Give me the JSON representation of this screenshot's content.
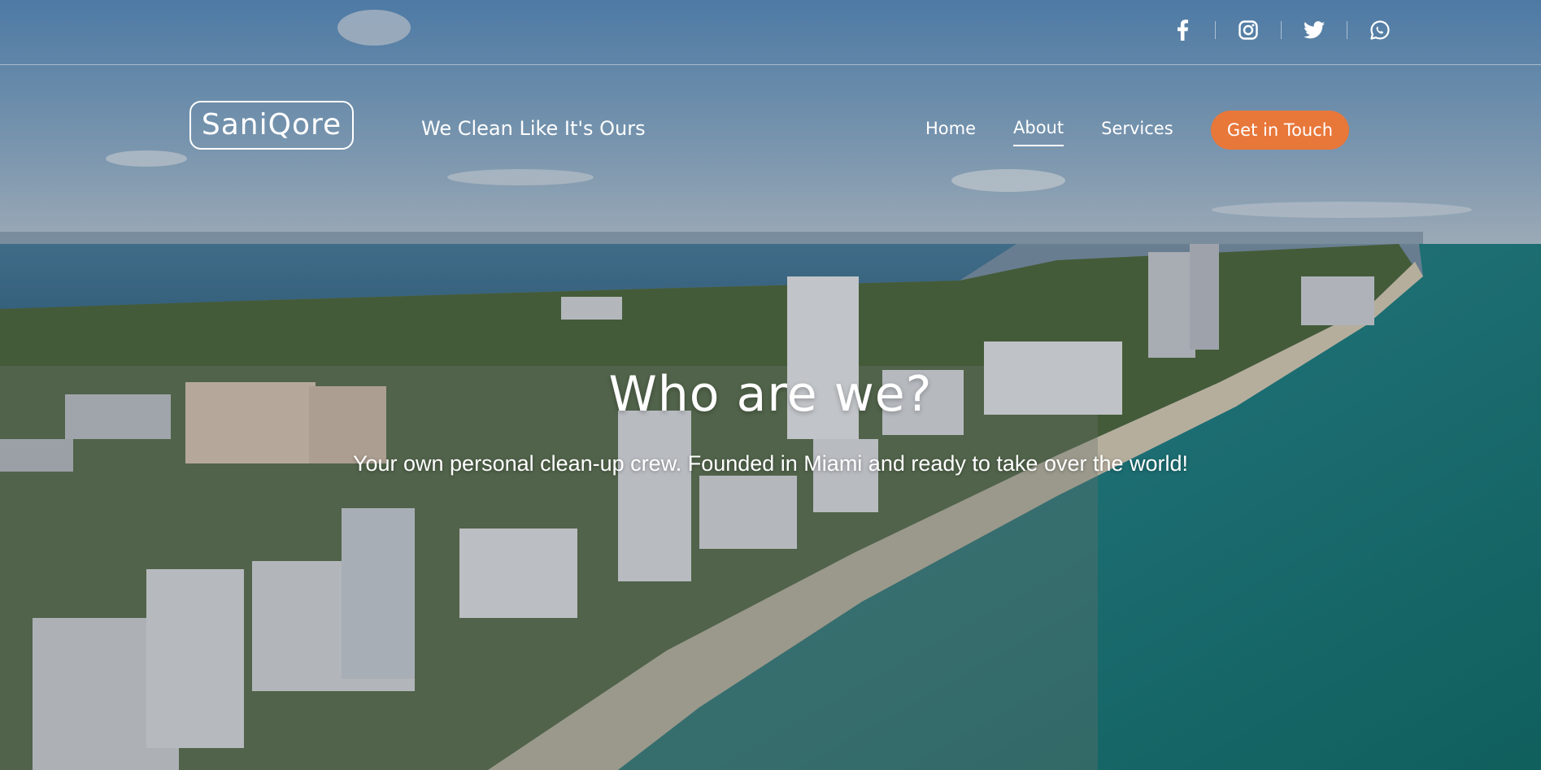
{
  "brand": {
    "logo_text": "SaniQore",
    "tagline": "We Clean Like It's Ours"
  },
  "social": {
    "items": [
      {
        "name": "facebook",
        "icon": "facebook-icon"
      },
      {
        "name": "instagram",
        "icon": "instagram-icon"
      },
      {
        "name": "twitter",
        "icon": "twitter-icon"
      },
      {
        "name": "whatsapp",
        "icon": "whatsapp-icon"
      }
    ]
  },
  "nav": {
    "items": [
      {
        "label": "Home",
        "active": false
      },
      {
        "label": "About",
        "active": true
      },
      {
        "label": "Services",
        "active": false
      }
    ],
    "cta_label": "Get in Touch"
  },
  "hero": {
    "title": "Who are we?",
    "subtitle": "Your own personal clean-up crew. Founded in Miami and ready to take over the world!"
  },
  "colors": {
    "accent": "#e8773a",
    "text": "#ffffff",
    "sky": "#6f96bf",
    "ocean": "#1f8a86"
  }
}
